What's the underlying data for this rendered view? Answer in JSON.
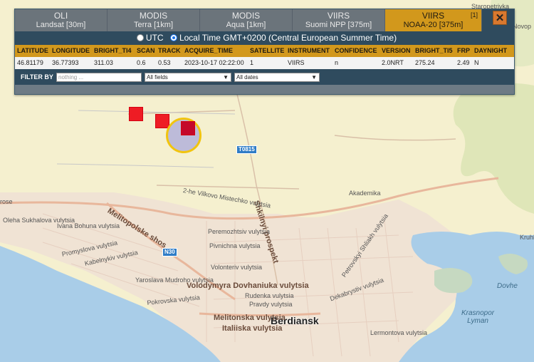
{
  "tabs": [
    {
      "line1": "OLI",
      "line2": "Landsat [30m]"
    },
    {
      "line1": "MODIS",
      "line2": "Terra [1km]"
    },
    {
      "line1": "MODIS",
      "line2": "Aqua [1km]"
    },
    {
      "line1": "VIIRS",
      "line2": "Suomi NPP [375m]"
    },
    {
      "line1": "VIIRS",
      "line2": "NOAA-20 [375m]",
      "badge": "[1]"
    }
  ],
  "close_label": "✕",
  "timezone": {
    "utc_label": "UTC",
    "local_label": "Local Time GMT+0200 (Central European Summer Time)"
  },
  "table": {
    "headers": [
      "LATITUDE",
      "LONGITUDE",
      "BRIGHT_TI4",
      "SCAN",
      "TRACK",
      "ACQUIRE_TIME",
      "SATELLITE",
      "INSTRUMENT",
      "CONFIDENCE",
      "VERSION",
      "BRIGHT_TI5",
      "FRP",
      "DAYNIGHT"
    ],
    "row": [
      "46.81179",
      "36.77393",
      "311.03",
      "0.6",
      "0.53",
      "2023-10-17 02:22:00",
      "1",
      "VIIRS",
      "n",
      "2.0NRT",
      "275.24",
      "2.49",
      "N"
    ]
  },
  "filter": {
    "label": "FILTER BY",
    "placeholder": "nothing ...",
    "field_select": "All fields",
    "date_select": "All dates"
  },
  "map": {
    "places": {
      "starop": "Staropetrivka",
      "novop": "Novop",
      "city": "Berdiansk",
      "krasnopor": "Krasnopor\nLyman",
      "dovhe": "Dovhe",
      "kruhl": "Kruhl",
      "rose": "rose"
    },
    "roads": {
      "t0815": "T0815",
      "n30": "N30",
      "melitopolske": "Melitopolske shos",
      "shkilnyi": "Shkilnyi prospekt",
      "volodymyra": "Volodymyra Dovhaniuka vulytsia",
      "melitonska": "Melitonska vulytsia",
      "italiiska": "Italiiska vulytsia",
      "akademika": "Akademika",
      "peremozhtsiv": "Peremozhtsiv vulytsia",
      "pivnichna": "Pivnichna vulytsia",
      "volonteriv": "Volonteriv vulytsia",
      "vilkovo": "2-he Vilkovo Mistechko vulytsia",
      "oleha": "Oleha Sukhalova vulytsia",
      "ivana": "Ivana Bohuna vulytsia",
      "promyslova": "Promyslova vulytsia",
      "kabelnykiv": "Kabelnykiv vulytsia",
      "yaroslava": "Yaroslava Mudroho vulytsia",
      "pokrovska": "Pokrovska vulytsia",
      "rudenka": "Rudenka vulytsia",
      "pravdy": "Pravdy vulytsia",
      "dekabrystiv": "Dekabrystiv vulytsia",
      "petrovskyi": "Petrovskyi Shliakh vulytsia",
      "lermontova": "Lermontova vulytsia"
    }
  },
  "colors": {
    "tab_active": "#d2981c",
    "tab_inactive": "#6b747b",
    "panel": "#2f4b5e",
    "fire": "#ee1c24",
    "selection_ring": "#f1c40f",
    "sea": "#a9cde8",
    "land": "#f5f0cf"
  }
}
